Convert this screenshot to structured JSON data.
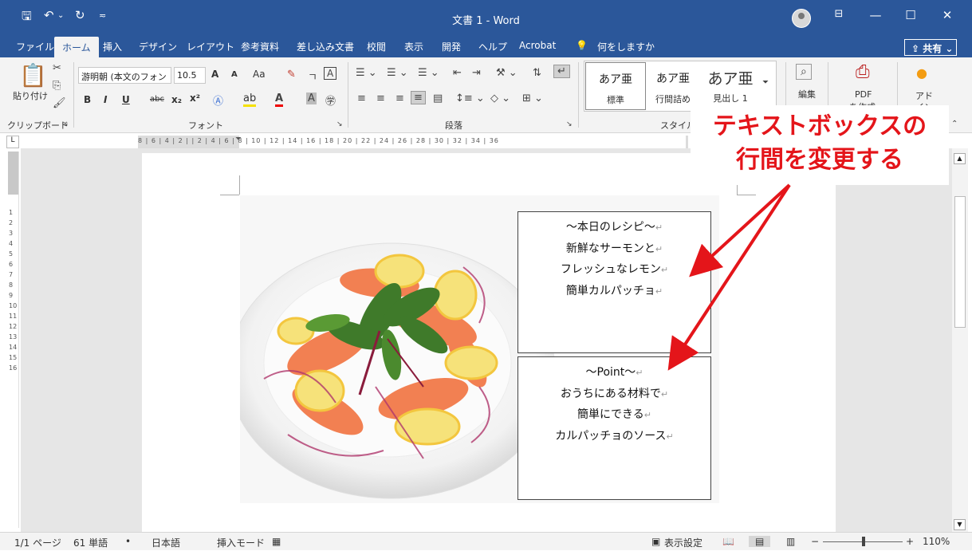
{
  "window": {
    "title": "文書 1 - Word"
  },
  "tabs": [
    "ファイル",
    "ホーム",
    "挿入",
    "デザイン",
    "レイアウト",
    "参考資料",
    "差し込み文書",
    "校閲",
    "表示",
    "開発",
    "ヘルプ",
    "Acrobat"
  ],
  "active_tab": "ホーム",
  "tell_me": "何をしますか",
  "share_label": "共有",
  "ribbon": {
    "clipboard": {
      "paste_label": "貼り付け",
      "group_label": "クリップボード"
    },
    "font": {
      "font_name": "游明朝 (本文のフォン",
      "font_size": "10.5",
      "group_label": "フォント",
      "grow_glyph": "A",
      "shrink_glyph": "A",
      "case_glyph": "Aa",
      "bold": "B",
      "italic": "I",
      "underline": "U",
      "strike": "abc",
      "subscript": "x₂",
      "superscript": "x²"
    },
    "paragraph": {
      "group_label": "段落"
    },
    "styles": {
      "group_label": "スタイル",
      "items": [
        {
          "sample": "あア亜",
          "name": "標準"
        },
        {
          "sample": "あア亜",
          "name": "行間詰め"
        },
        {
          "sample": "あア亜",
          "name": "見出し 1"
        }
      ]
    },
    "editing": {
      "label": "編集"
    },
    "pdf": {
      "label": "PDF",
      "label2": "を作成"
    },
    "addin": {
      "label": "アド",
      "label2": "イン"
    }
  },
  "ruler": {
    "horizontal": "8 | 6 | 4 | 2 |   | 2 | 4 | 6 | 8 | 10 | 12 | 14 | 16 | 18 | 20 | 22 | 24 | 26 | 28 | 30 | 32 | 34 | 36",
    "vertical": "1 2 3 4 5 6 7 8 9 10 11 12 13 14 15 16"
  },
  "document": {
    "textbox1": {
      "lines": [
        "～本日のレシピ～",
        "新鮮なサーモンと",
        "フレッシュなレモン",
        "簡単カルパッチョ"
      ]
    },
    "textbox2": {
      "lines": [
        "～Point～",
        "おうちにある材料で",
        "簡単にできる",
        "カルパッチョのソース"
      ]
    },
    "paragraph_mark": "↵"
  },
  "annotation": {
    "line1": "テキストボックスの",
    "line2": "行間を変更する",
    "color": "#e4151a"
  },
  "statusbar": {
    "page": "1/1 ページ",
    "words": "61 単語",
    "language": "日本語",
    "mode": "挿入モード",
    "display_settings": "表示設定",
    "zoom": "110%"
  },
  "colors": {
    "brand": "#2b579a",
    "ribbon_bg": "#f3f3f3",
    "workspace_bg": "#e6e6e6"
  }
}
